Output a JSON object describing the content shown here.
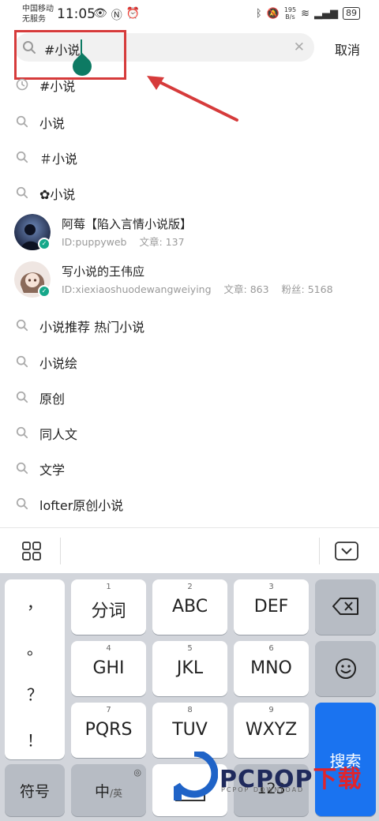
{
  "status_bar": {
    "carrier_line1": "中国移动",
    "carrier_line2": "无服务",
    "time": "11:05",
    "speed_value": "195",
    "speed_unit": "B/s",
    "battery": "89"
  },
  "search": {
    "query": "#小说",
    "cancel_label": "取消"
  },
  "suggestions_top": [
    {
      "text": "#小说",
      "icon": "history-icon"
    },
    {
      "text": "小说",
      "icon": "search-icon"
    },
    {
      "text": "＃小说",
      "icon": "search-icon"
    },
    {
      "text": "✿小说",
      "icon": "search-icon"
    }
  ],
  "users": [
    {
      "name": "阿莓【陷入言情小说版】",
      "id": "ID:puppyweb",
      "articles": "文章: 137",
      "fans": ""
    },
    {
      "name": "写小说的王伟应",
      "id": "ID:xiexiaoshuodewangweiying",
      "articles": "文章: 863",
      "fans": "粉丝: 5168"
    }
  ],
  "suggestions_bottom": [
    {
      "text": "小说推荐 热门小说"
    },
    {
      "text": "小说绘"
    },
    {
      "text": "原创"
    },
    {
      "text": "同人文"
    },
    {
      "text": "文学"
    },
    {
      "text": "lofter原创小说"
    }
  ],
  "keyboard": {
    "punct": [
      "，",
      "。",
      "？",
      "！"
    ],
    "row1": [
      {
        "num": "1",
        "label": "分词"
      },
      {
        "num": "2",
        "label": "ABC"
      },
      {
        "num": "3",
        "label": "DEF"
      }
    ],
    "row2": [
      {
        "num": "4",
        "label": "GHI"
      },
      {
        "num": "5",
        "label": "JKL"
      },
      {
        "num": "6",
        "label": "MNO"
      }
    ],
    "row3": [
      {
        "num": "7",
        "label": "PQRS"
      },
      {
        "num": "8",
        "label": "TUV"
      },
      {
        "num": "9",
        "label": "WXYZ"
      }
    ],
    "symbol_label": "符号",
    "lang_main": "中",
    "lang_sub": "/英",
    "num_label": "123",
    "search_label": "搜索"
  },
  "watermark": {
    "brand_a": "PCPOP",
    "brand_b": "下载",
    "sub": "PCPOP DOWNLOAD"
  },
  "colors": {
    "accent_green": "#0d7a63",
    "annotation_red": "#d63b3b",
    "keyboard_blue": "#1a73f0"
  }
}
